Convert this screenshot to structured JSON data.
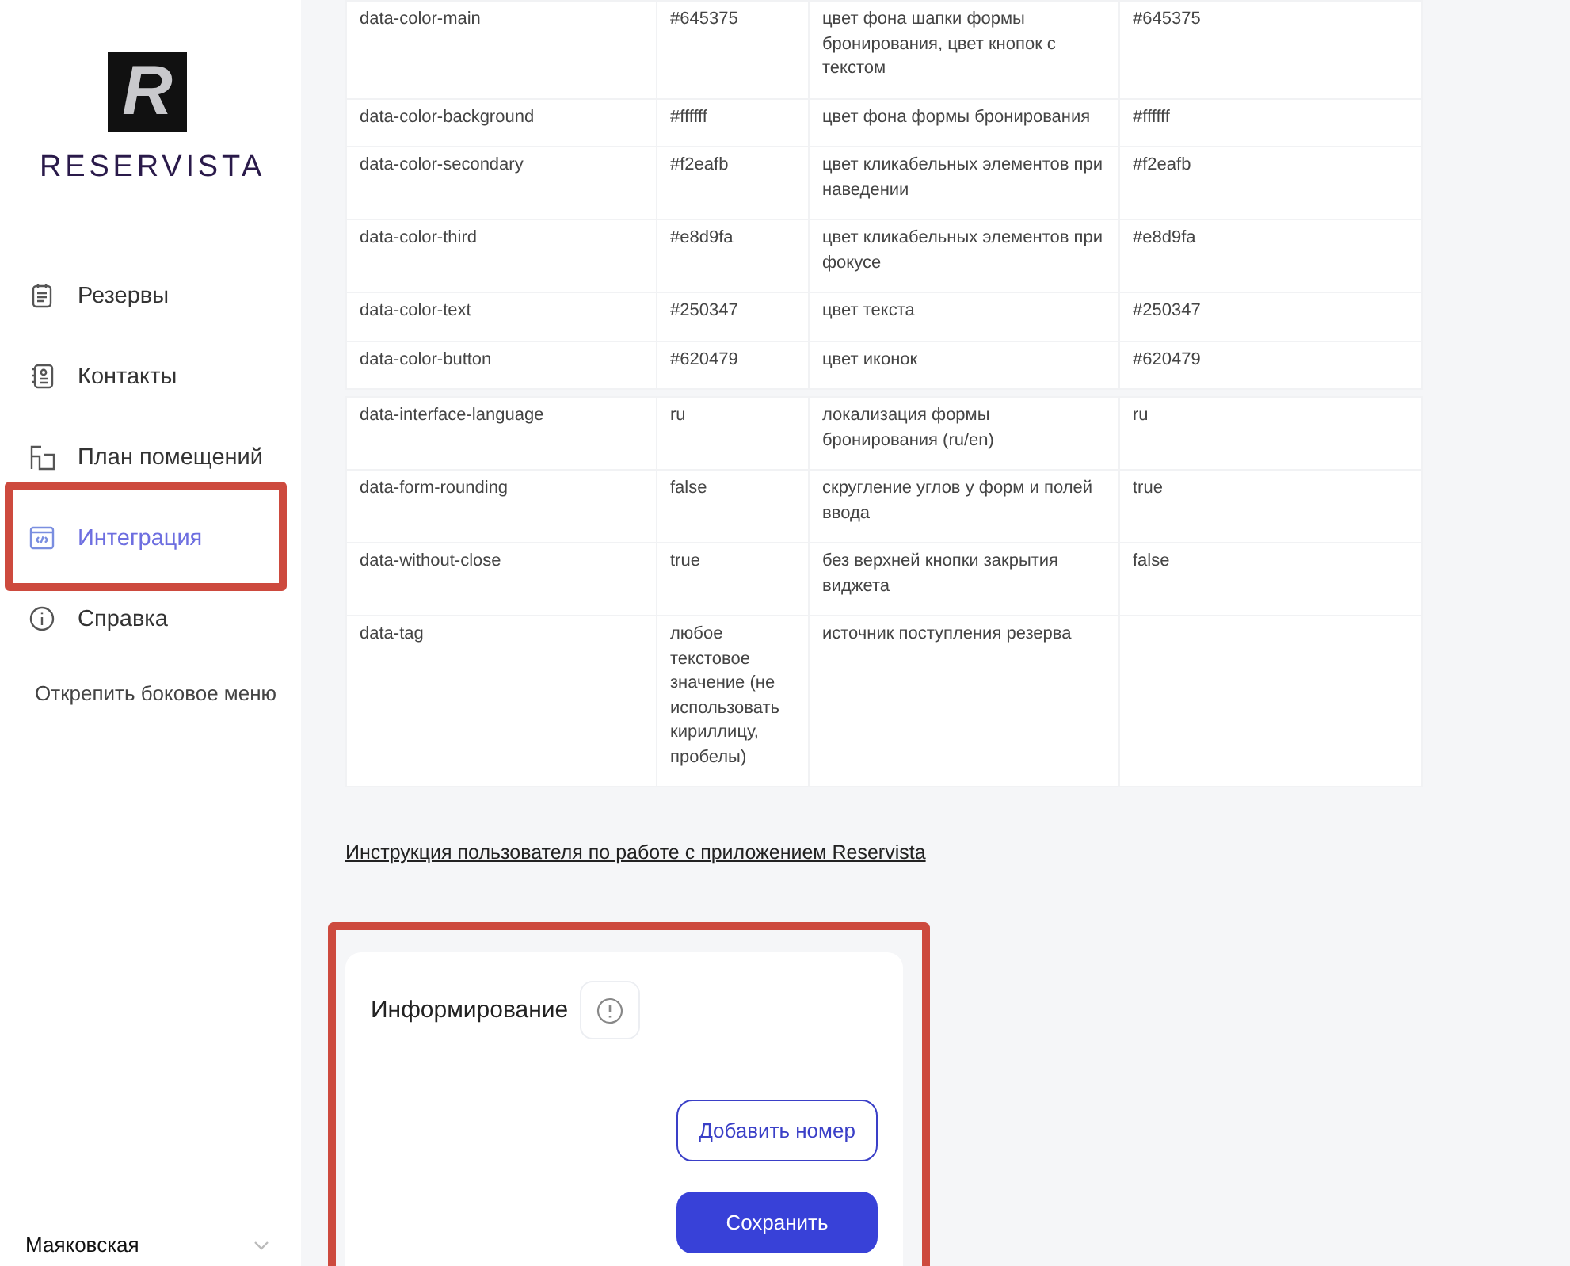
{
  "sidebar": {
    "logo_letter": "R",
    "brand": "RESERVISTA",
    "nav": [
      {
        "label": "Резервы",
        "selected": false,
        "highlighted": false
      },
      {
        "label": "Контакты",
        "selected": false,
        "highlighted": false
      },
      {
        "label": "План помещений",
        "selected": false,
        "highlighted": false
      },
      {
        "label": "Интеграция",
        "selected": true,
        "highlighted": true
      },
      {
        "label": "Справка",
        "selected": false,
        "highlighted": false
      }
    ],
    "unpin": "Открепить боковое меню",
    "location": "Маяковская"
  },
  "param_tables": [
    {
      "rows": [
        [
          "data-color-main",
          "#645375",
          "цвет фона шапки формы бронирования, цвет кнопок с текстом",
          "#645375"
        ],
        [
          "data-color-background",
          "#ffffff",
          "цвет фона формы бронирования",
          "#ffffff"
        ],
        [
          "data-color-secondary",
          "#f2eafb",
          "цвет кликабельных элементов при наведении",
          "#f2eafb"
        ],
        [
          "data-color-third",
          "#e8d9fa",
          "цвет кликабельных элементов при фокусе",
          "#e8d9fa"
        ],
        [
          "data-color-text",
          "#250347",
          "цвет текста",
          "#250347"
        ],
        [
          "data-color-button",
          "#620479",
          "цвет иконок",
          "#620479"
        ]
      ]
    },
    {
      "rows": [
        [
          "data-interface-language",
          "ru",
          "локализация формы бронирования (ru/en)",
          "ru"
        ],
        [
          "data-form-rounding",
          "false",
          "скругление углов у форм и полей ввода",
          "true"
        ],
        [
          "data-without-close",
          "true",
          "без верхней кнопки закрытия виджета",
          "false"
        ],
        [
          "data-tag",
          "любое текстовое значение (не использовать кириллицу, пробелы)",
          "источник поступления резерва",
          ""
        ]
      ]
    }
  ],
  "manual_link": "Инструкция пользователя по работе с приложением Reservista",
  "notify_card": {
    "title": "Информирование",
    "highlighted": true,
    "buttons": [
      {
        "label": "Добавить номер",
        "kind": "outline"
      },
      {
        "label": "Сохранить",
        "kind": "primary"
      }
    ]
  }
}
